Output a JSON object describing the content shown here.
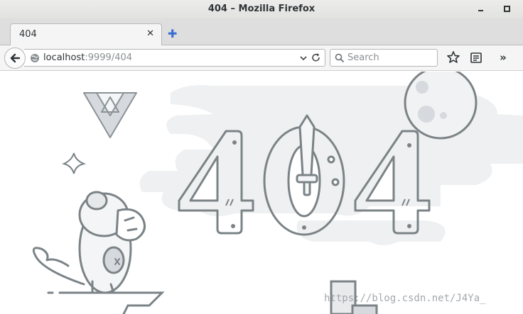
{
  "window": {
    "title": "404 – Mozilla Firefox"
  },
  "tabs": [
    {
      "label": "404",
      "close_icon": "close-icon"
    }
  ],
  "newtab": {
    "icon": "plus-icon",
    "glyph": "✚"
  },
  "navbar": {
    "url_host": "localhost",
    "url_path": ":9999/404",
    "search_placeholder": "Search",
    "overflow_glyph": "»"
  },
  "page": {
    "illustration": "404",
    "watermark": "https://blog.csdn.net/J4Ya_"
  }
}
